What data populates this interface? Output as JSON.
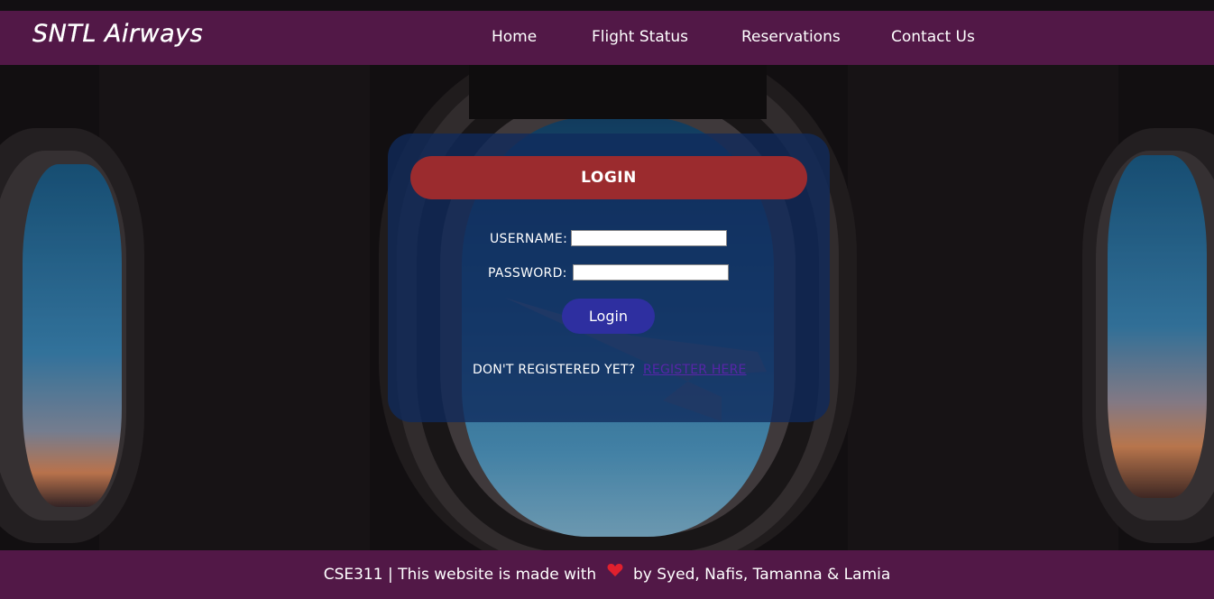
{
  "brand": {
    "logo_text": "SNTL Airways"
  },
  "nav": {
    "items": [
      {
        "label": "Home"
      },
      {
        "label": "Flight Status"
      },
      {
        "label": "Reservations"
      },
      {
        "label": "Contact Us"
      }
    ]
  },
  "login": {
    "header": "LOGIN",
    "username_label": "USERNAME:",
    "username_value": "",
    "password_label": "PASSWORD:",
    "password_value": "",
    "submit_label": "Login",
    "register_prompt": "DON'T REGISTERED YET?",
    "register_link": "REGISTER HERE"
  },
  "footer": {
    "text_before": "CSE311 | This website is made with",
    "heart_icon": "heart-icon",
    "text_after": "by Syed, Nafis, Tamanna & Lamia"
  },
  "colors": {
    "navbar": "#521847",
    "footer": "#521847",
    "login_header": "#9b2b2e",
    "login_button": "#2e2fa0",
    "panel": "#102a5c",
    "register_link": "#5726a8",
    "heart": "#e0202e"
  }
}
